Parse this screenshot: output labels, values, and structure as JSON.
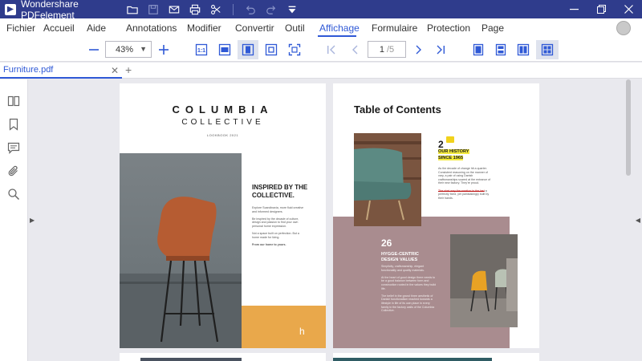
{
  "app": {
    "title": "Wondershare PDFelement"
  },
  "menu": {
    "items": [
      "Fichier",
      "Accueil",
      "Aide",
      "Annotations",
      "Modifier",
      "Convertir",
      "Outil",
      "Affichage",
      "Formulaire",
      "Protection",
      "Page"
    ],
    "active": "Affichage"
  },
  "toolbar": {
    "zoom": "43%",
    "page_current": "1",
    "page_total": "/5"
  },
  "tabs": {
    "document": "Furniture.pdf",
    "add_label": "+"
  },
  "document": {
    "left_page": {
      "brand_line1": "COLUMBIA",
      "brand_line2": "COLLECTIVE",
      "brand_line3": "LOOKBOOK 2021",
      "heading": "INSPIRED BY THE COLLECTIVE.",
      "yellow_mark": "h"
    },
    "right_page": {
      "toc_title": "Table of Contents",
      "section1_number": "2",
      "section1_title_line1": "OUR HISTORY",
      "section1_title_line2": "SINCE 1965",
      "section2_number": "26",
      "section2_title_line1": "HYGGE-CENTRIC",
      "section2_title_line2": "DESIGN VALUES"
    }
  },
  "colors": {
    "titlebar": "#2f3c8c",
    "accent": "#2f59d6",
    "highlight": "#f4ea40",
    "mauve": "#a98c8f",
    "mustard": "#e9a84b"
  }
}
